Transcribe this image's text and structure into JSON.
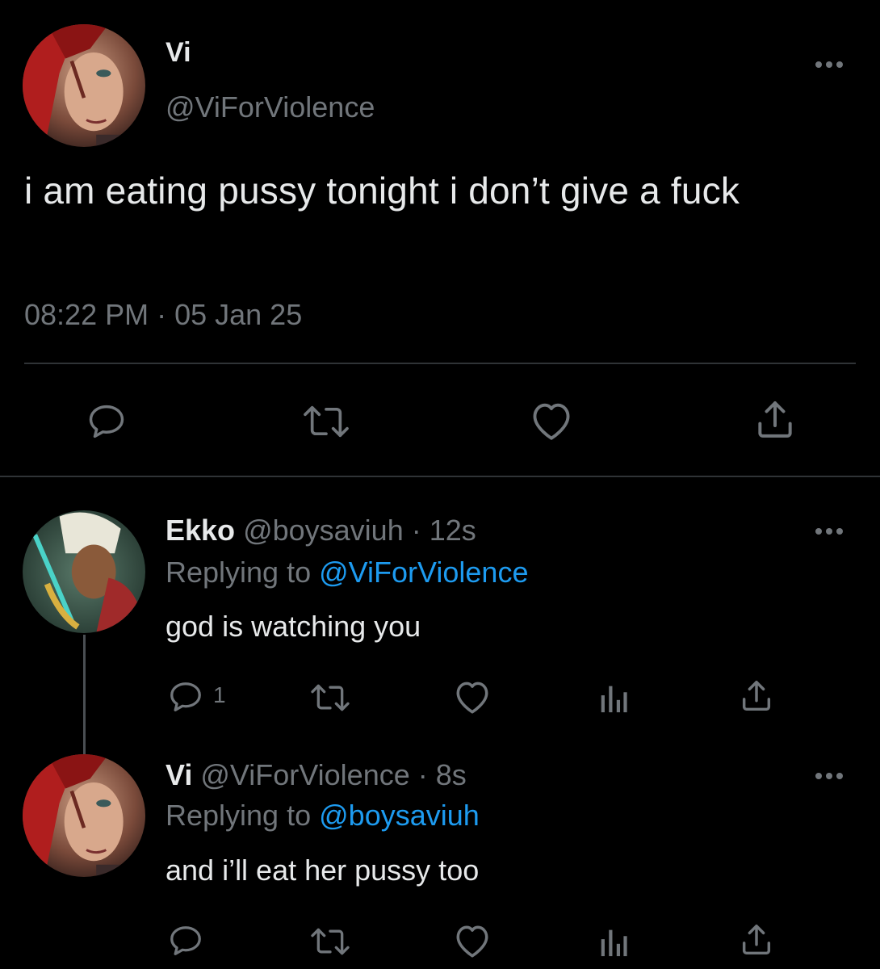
{
  "main_tweet": {
    "name": "Vi",
    "handle": "@ViForViolence",
    "text": "i am eating pussy tonight i don’t give a fuck",
    "meta": "08:22 PM · 05 Jan 25",
    "avatar_icon": "vi-avatar"
  },
  "replies": [
    {
      "name": "Ekko",
      "handle": "@boysaviuh",
      "time": "· 12s",
      "replying_prefix": "Replying to",
      "replying_to": "@ViForViolence",
      "text": "god is watching you",
      "reply_count": "1",
      "avatar_icon": "ekko-avatar"
    },
    {
      "name": "Vi",
      "handle": "@ViForViolence",
      "time": "· 8s",
      "replying_prefix": "Replying to",
      "replying_to": "@boysaviuh",
      "text": "and i’ll eat her pussy too",
      "reply_count": "",
      "avatar_icon": "vi-avatar"
    }
  ],
  "colors": {
    "background": "#000000",
    "text": "#e7e9ea",
    "secondary": "#71767b",
    "link": "#1d9bf0",
    "divider": "#2f3336"
  }
}
